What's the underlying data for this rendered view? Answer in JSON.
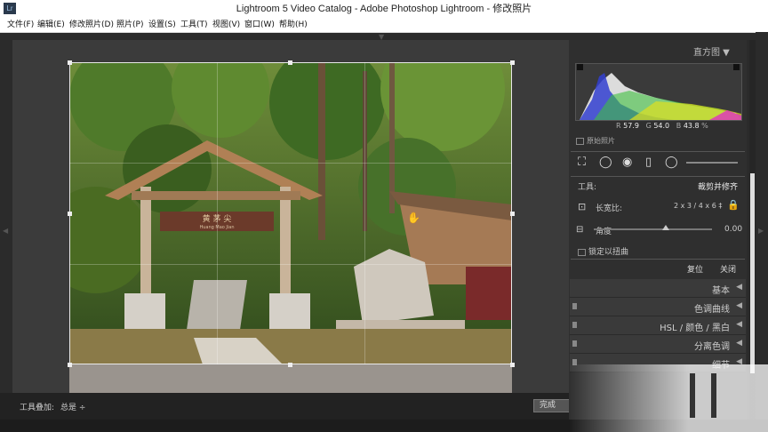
{
  "window": {
    "title": "Lightroom 5 Video Catalog - Adobe Photoshop Lightroom - 修改照片",
    "app_icon": "Lr"
  },
  "menu": [
    "文件(F)",
    "编辑(E)",
    "修改照片(D)",
    "照片(P)",
    "设置(S)",
    "工具(T)",
    "视图(V)",
    "窗口(W)",
    "帮助(H)"
  ],
  "photo_sign": {
    "title": "黄 茅 尖",
    "subtitle": "Huang Mao Jian"
  },
  "right_panel": {
    "histogram_title": "直方图",
    "rgb": {
      "r_label": "R",
      "r": "57.9",
      "g_label": "G",
      "g": "54.0",
      "b_label": "B",
      "b": "43.8",
      "unit": "%"
    },
    "original_photo": "原始照片",
    "tool_label": "工具:",
    "tool_name": "裁剪并修齐",
    "aspect_label": "长宽比:",
    "aspect_value": "2 x 3 / 4 x 6 ‡",
    "angle_label": "角度",
    "angle_value": "0.00",
    "lock_warp": "锁定以扭曲",
    "reset": "复位",
    "close": "关闭",
    "sections": [
      {
        "name": "基本",
        "switch": false
      },
      {
        "name": "色调曲线",
        "switch": true
      },
      {
        "name": "HSL / 颜色 / 黑白",
        "switch": true
      },
      {
        "name": "分离色调",
        "switch": true
      },
      {
        "name": "细节",
        "switch": true
      }
    ]
  },
  "toolbar": {
    "overlay_label": "工具叠加:",
    "overlay_value": "总是 ÷",
    "done": "完成"
  },
  "colors": {
    "panel_bg": "#2f2f2f",
    "work_bg": "#3b3b3b",
    "toolbar_bg": "#222222"
  }
}
